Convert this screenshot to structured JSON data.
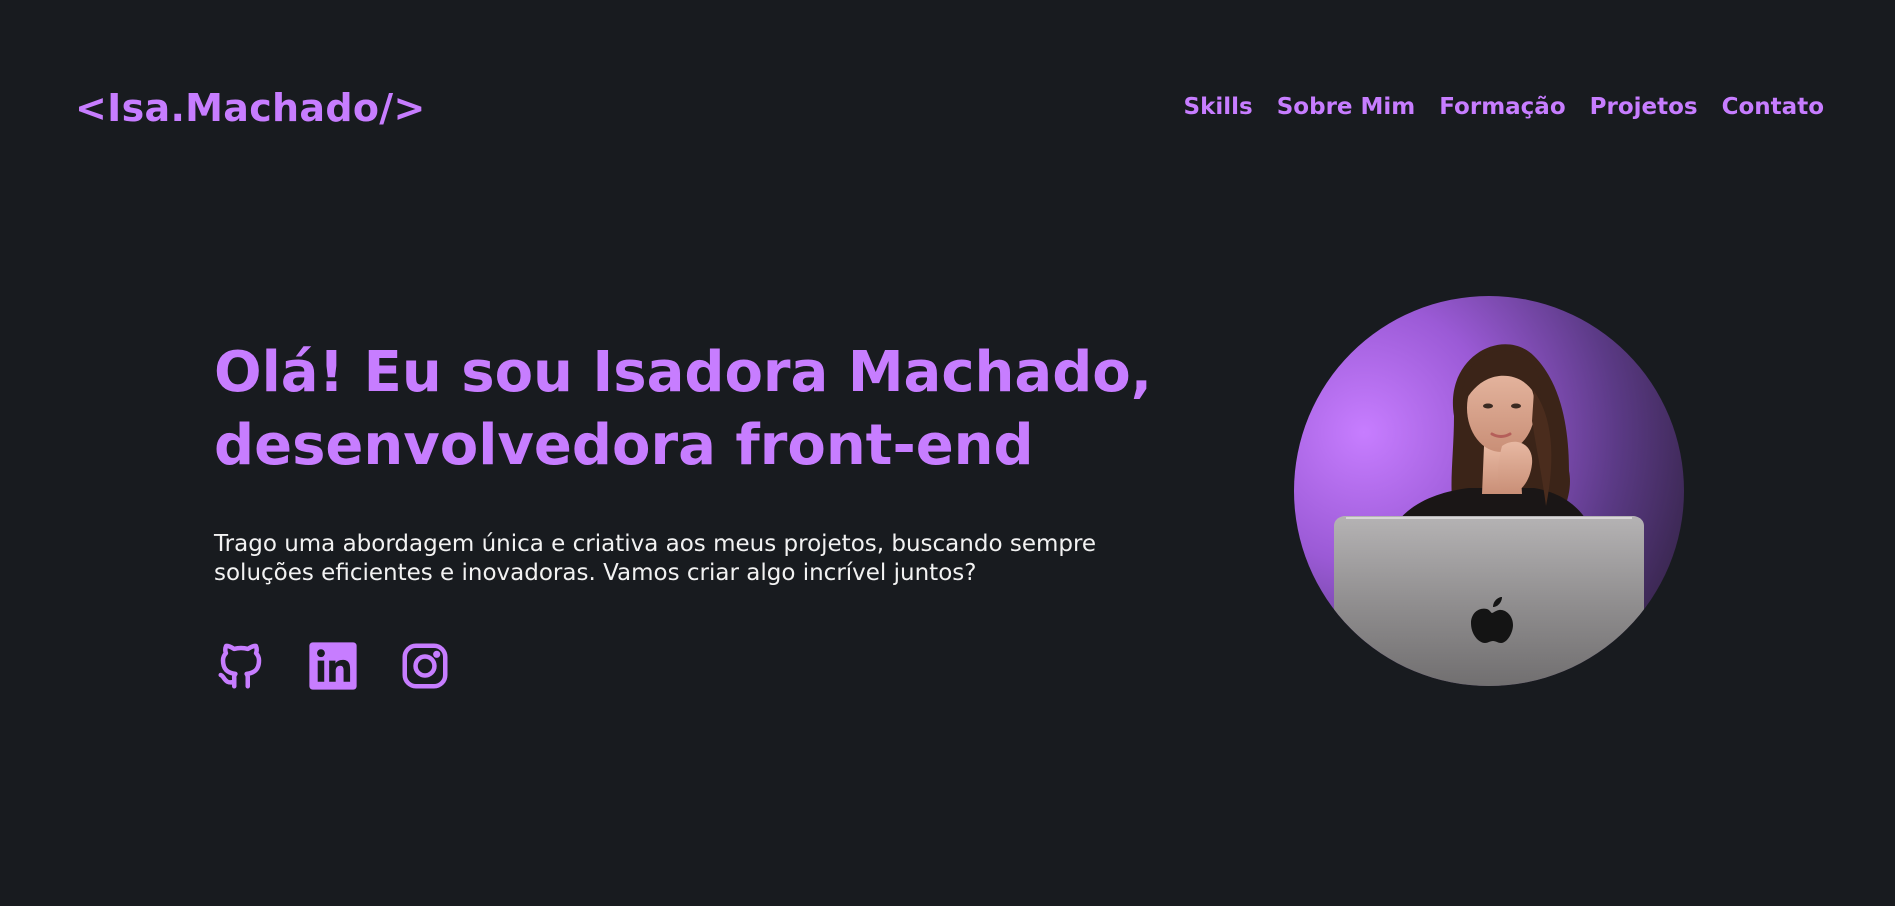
{
  "header": {
    "logo": "<Isa.Machado/>",
    "nav": [
      "Skills",
      "Sobre Mim",
      "Formação",
      "Projetos",
      "Contato"
    ]
  },
  "hero": {
    "headline_line1": "Olá! Eu sou Isadora Machado,",
    "headline_line2": "desenvolvedora front-end",
    "description_line1": "Trago uma abordagem única e criativa aos meus projetos, buscando sempre",
    "description_line2": "soluções eficientes e inovadoras. Vamos criar algo incrível juntos?"
  },
  "socials": {
    "icons": [
      "github-icon",
      "linkedin-icon",
      "instagram-icon"
    ]
  },
  "colors": {
    "background": "#181b1f",
    "accent": "#c77dff",
    "text": "#f2f2f2"
  }
}
